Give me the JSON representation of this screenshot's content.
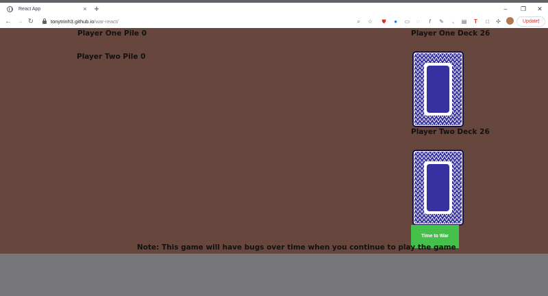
{
  "browser": {
    "tab_title": "React App",
    "tab_close": "×",
    "new_tab": "+",
    "url_host": "tonytrinh3.github.io",
    "url_path": "/war-react/",
    "update_label": "Update",
    "update_menu": "⋮",
    "window_controls": {
      "minimize": "–",
      "maximize": "❐",
      "close": "✕"
    },
    "nav": {
      "back": "←",
      "forward": "→",
      "reload": "↻"
    }
  },
  "game": {
    "player_one_pile": "Player One Pile 0",
    "player_two_pile": "Player Two Pile 0",
    "player_one_deck": "Player One Deck 26",
    "player_two_deck": "Player Two Deck 26",
    "war_button": "Time to War",
    "note": "Note: This game will have bugs over time when you continue to play the game"
  },
  "colors": {
    "background": "#67463d",
    "card_back": "#3730a0",
    "war_button": "#45c04a"
  }
}
